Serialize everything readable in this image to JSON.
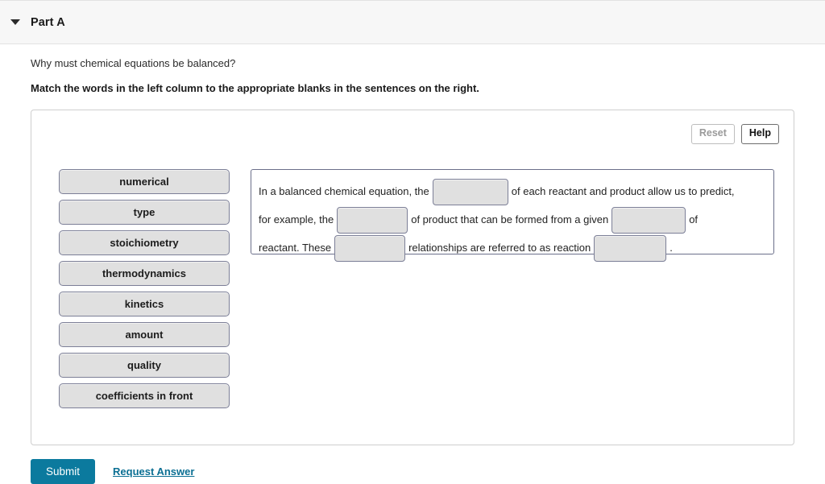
{
  "header": {
    "title": "Part A",
    "collapse_icon": "caret-down-icon"
  },
  "question": {
    "prompt": "Why must chemical equations be balanced?",
    "instruction": "Match the words in the left column to the appropriate blanks in the sentences on the right."
  },
  "toolbar": {
    "reset_label": "Reset",
    "help_label": "Help"
  },
  "word_bank": {
    "items": [
      {
        "label": "numerical"
      },
      {
        "label": "type"
      },
      {
        "label": "stoichiometry"
      },
      {
        "label": "thermodynamics"
      },
      {
        "label": "kinetics"
      },
      {
        "label": "amount"
      },
      {
        "label": "quality"
      },
      {
        "label": "coefficients in front"
      }
    ]
  },
  "sentence": {
    "fragments": [
      {
        "type": "text",
        "value": "In a balanced chemical equation, the "
      },
      {
        "type": "blank",
        "value": ""
      },
      {
        "type": "text",
        "value": " of each reactant and product allow us to predict, for example, the "
      },
      {
        "type": "blank",
        "value": ""
      },
      {
        "type": "text",
        "value": " of product that can be formed from a given "
      },
      {
        "type": "blank",
        "value": ""
      },
      {
        "type": "text",
        "value": " of reactant. These "
      },
      {
        "type": "blank",
        "value": ""
      },
      {
        "type": "text",
        "value": " relationships are referred to as reaction "
      },
      {
        "type": "blank",
        "value": ""
      },
      {
        "type": "text",
        "value": " ."
      }
    ],
    "part1": "In a balanced chemical equation, the",
    "part2": "of each reactant and product allow us to predict,",
    "part3": "for example, the",
    "part4": "of product that can be formed from a given",
    "part5": "of",
    "part6": "reactant. These",
    "part7": "relationships are referred to as reaction",
    "part8": ".",
    "blank1_value": "",
    "blank2_value": "",
    "blank3_value": "",
    "blank4_value": "",
    "blank5_value": ""
  },
  "footer": {
    "submit_label": "Submit",
    "request_answer_label": "Request Answer"
  },
  "colors": {
    "submit_teal": "#0b7a9e",
    "link_teal": "#0b6f93",
    "chip_fill": "#e0e0e0",
    "chip_border": "#7c7f97",
    "header_bg": "#f7f7f7"
  }
}
